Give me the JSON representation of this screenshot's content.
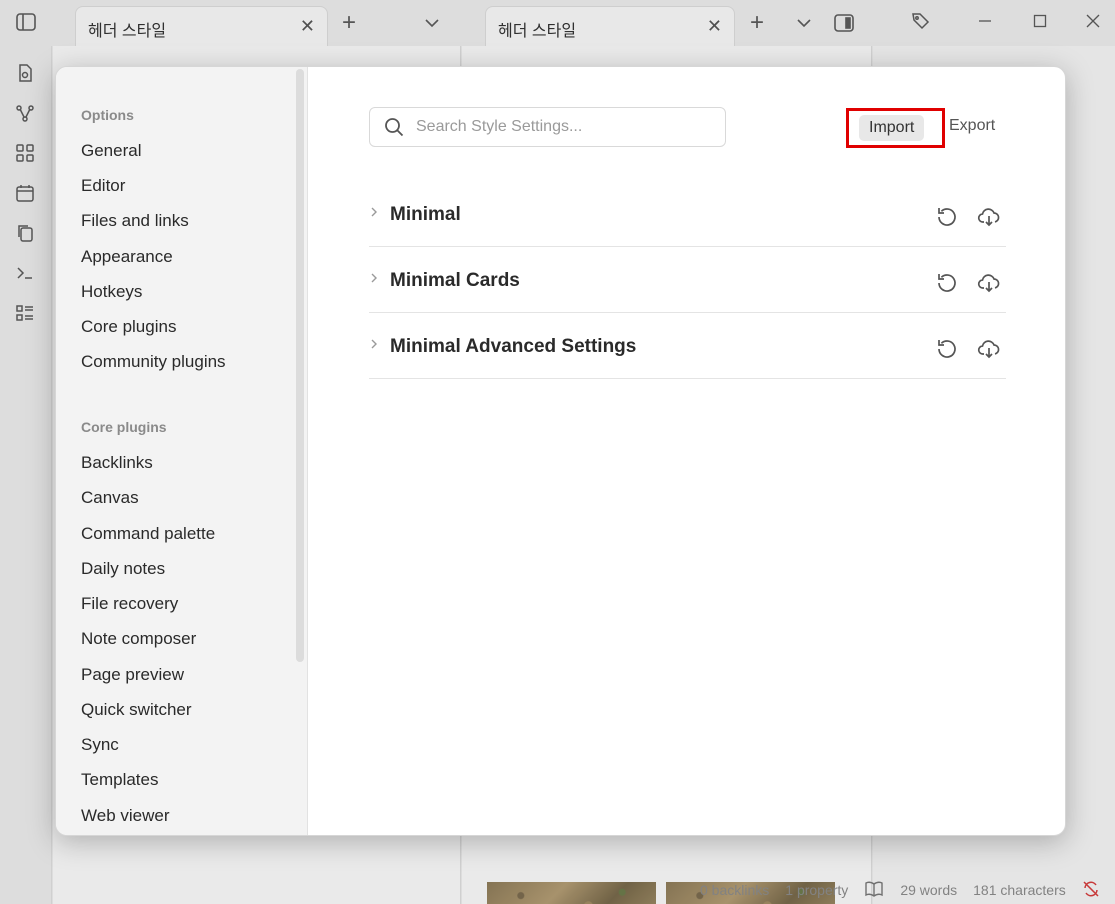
{
  "tabs": [
    {
      "title": "헤더 스타일"
    },
    {
      "title": "헤더 스타일"
    }
  ],
  "sidebar": {
    "options_title": "Options",
    "options_items": [
      {
        "label": "General"
      },
      {
        "label": "Editor"
      },
      {
        "label": "Files and links"
      },
      {
        "label": "Appearance"
      },
      {
        "label": "Hotkeys"
      },
      {
        "label": "Core plugins"
      },
      {
        "label": "Community plugins"
      }
    ],
    "core_title": "Core plugins",
    "core_items": [
      {
        "label": "Backlinks"
      },
      {
        "label": "Canvas"
      },
      {
        "label": "Command palette"
      },
      {
        "label": "Daily notes"
      },
      {
        "label": "File recovery"
      },
      {
        "label": "Note composer"
      },
      {
        "label": "Page preview"
      },
      {
        "label": "Quick switcher"
      },
      {
        "label": "Sync"
      },
      {
        "label": "Templates"
      },
      {
        "label": "Web viewer"
      }
    ]
  },
  "content": {
    "search_placeholder": "Search Style Settings...",
    "import_label": "Import",
    "export_label": "Export",
    "sections": [
      {
        "title": "Minimal"
      },
      {
        "title": "Minimal Cards"
      },
      {
        "title": "Minimal Advanced Settings"
      }
    ]
  },
  "status": {
    "backlinks": "0 backlinks",
    "properties": "1 property",
    "words": "29 words",
    "characters": "181 characters"
  },
  "colors": {
    "highlight": "#e00000",
    "sync_error": "#d23b3b"
  }
}
